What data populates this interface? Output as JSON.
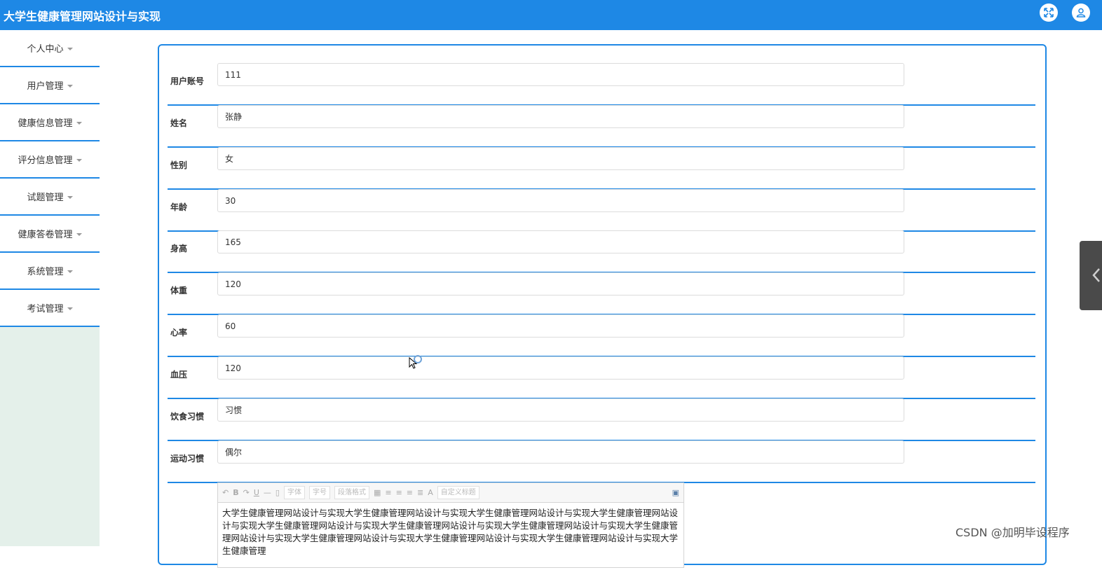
{
  "header": {
    "title": "大学生健康管理网站设计与实现",
    "icons": [
      "fullscreen-icon",
      "user-icon"
    ]
  },
  "sidebar": {
    "items": [
      {
        "label": "个人中心"
      },
      {
        "label": "用户管理"
      },
      {
        "label": "健康信息管理"
      },
      {
        "label": "评分信息管理"
      },
      {
        "label": "试题管理"
      },
      {
        "label": "健康答卷管理"
      },
      {
        "label": "系统管理"
      },
      {
        "label": "考试管理"
      }
    ]
  },
  "form": {
    "fields": [
      {
        "label": "用户账号",
        "value": "111"
      },
      {
        "label": "姓名",
        "value": "张静"
      },
      {
        "label": "性别",
        "value": "女"
      },
      {
        "label": "年龄",
        "value": "30"
      },
      {
        "label": "身高",
        "value": "165"
      },
      {
        "label": "体重",
        "value": "120"
      },
      {
        "label": "心率",
        "value": "60"
      },
      {
        "label": "血压",
        "value": "120"
      },
      {
        "label": "饮食习惯",
        "value": "习惯"
      },
      {
        "label": "运动习惯",
        "value": "偶尔"
      }
    ]
  },
  "editor": {
    "toolbar": {
      "font_family": "字体",
      "font_size": "字号",
      "paragraph_format": "段落格式",
      "custom_title": "自定义标题",
      "bold": "B",
      "underline": "U",
      "hr": "—",
      "font_color": "A"
    },
    "content": "大学生健康管理网站设计与实现大学生健康管理网站设计与实现大学生健康管理网站设计与实现大学生健康管理网站设计与实现大学生健康管理网站设计与实现大学生健康管理网站设计与实现大学生健康管理网站设计与实现大学生健康管理网站设计与实现大学生健康管理网站设计与实现大学生健康管理网站设计与实现大学生健康管理网站设计与实现大学生健康管理"
  },
  "watermark": "CSDN @加明毕设程序",
  "colors": {
    "primary": "#1e88e5",
    "sidebar_bg": "#e4f0ea"
  }
}
